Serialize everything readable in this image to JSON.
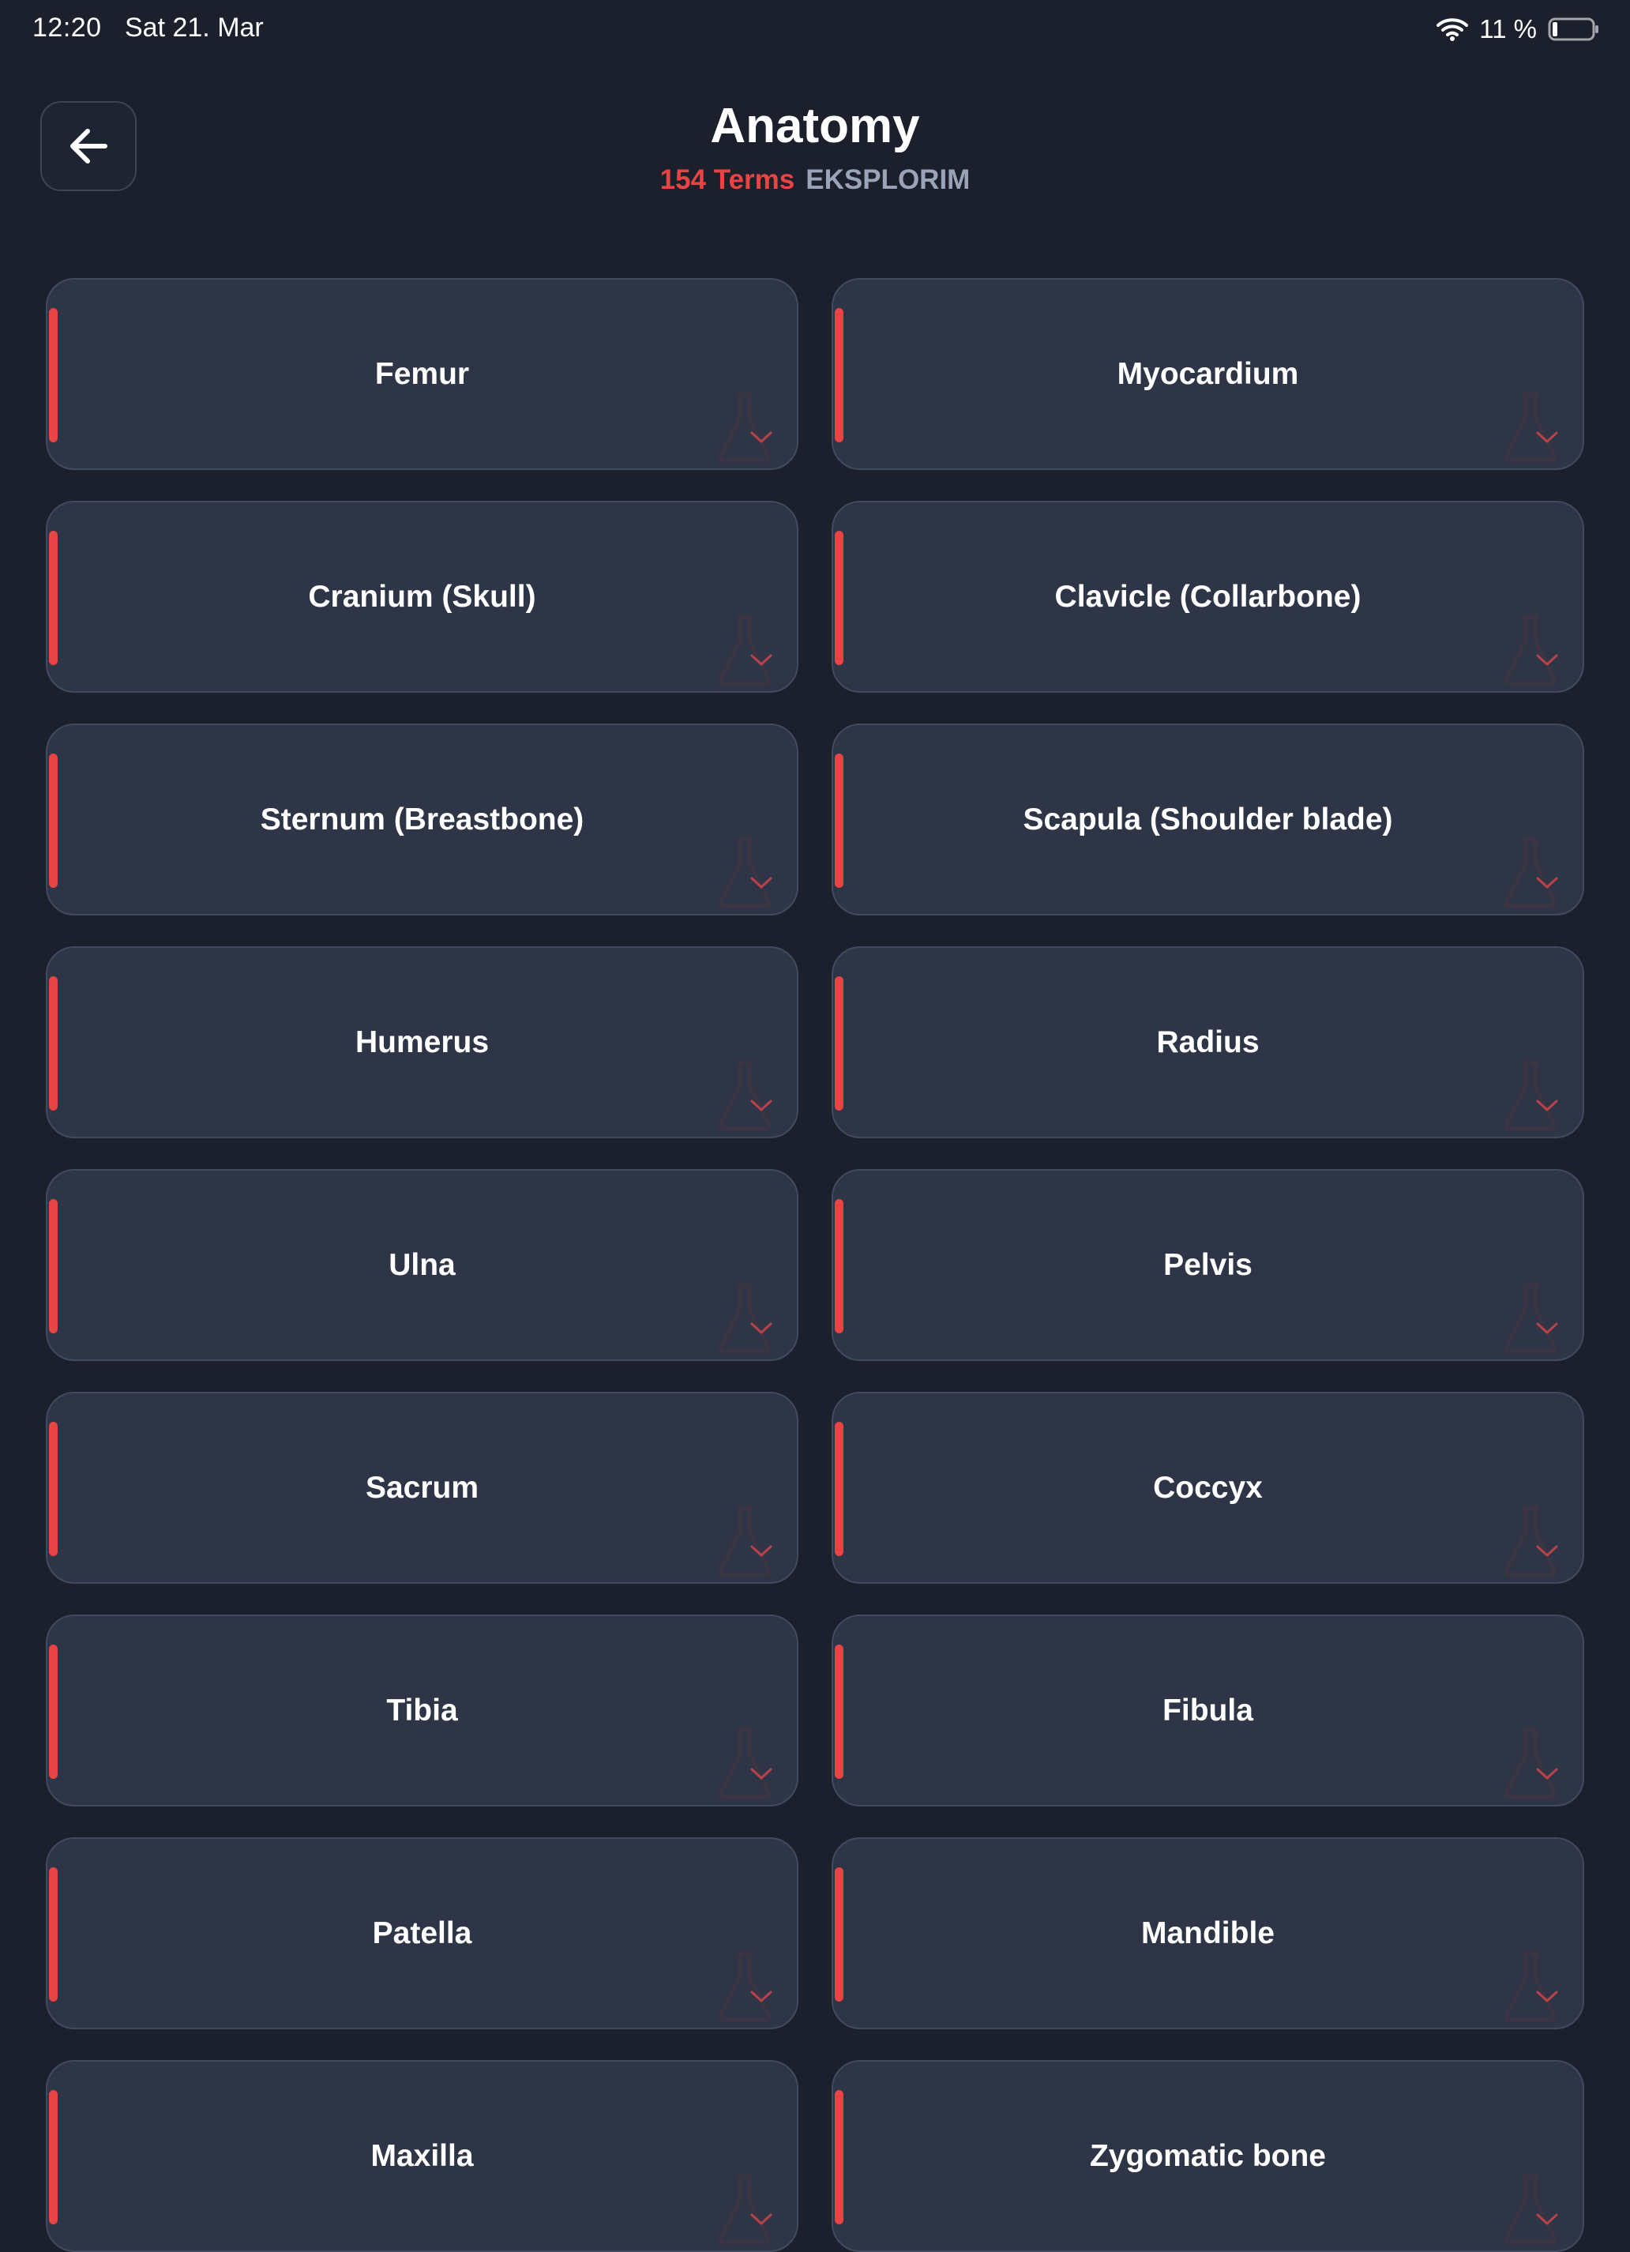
{
  "status_bar": {
    "time": "12:20",
    "date": "Sat 21. Mar",
    "battery": "11 %"
  },
  "header": {
    "title": "Anatomy",
    "term_count": "154 Terms",
    "mode": "EKSPLORIM"
  },
  "colors": {
    "background": "#1b202c",
    "card": "#2e3546",
    "accent": "#e84444",
    "muted": "#9aa3b8"
  },
  "terms": [
    "Femur",
    "Myocardium",
    "Cranium (Skull)",
    "Clavicle (Collarbone)",
    "Sternum (Breastbone)",
    "Scapula (Shoulder blade)",
    "Humerus",
    "Radius",
    "Ulna",
    "Pelvis",
    "Sacrum",
    "Coccyx",
    "Tibia",
    "Fibula",
    "Patella",
    "Mandible",
    "Maxilla",
    "Zygomatic bone"
  ]
}
